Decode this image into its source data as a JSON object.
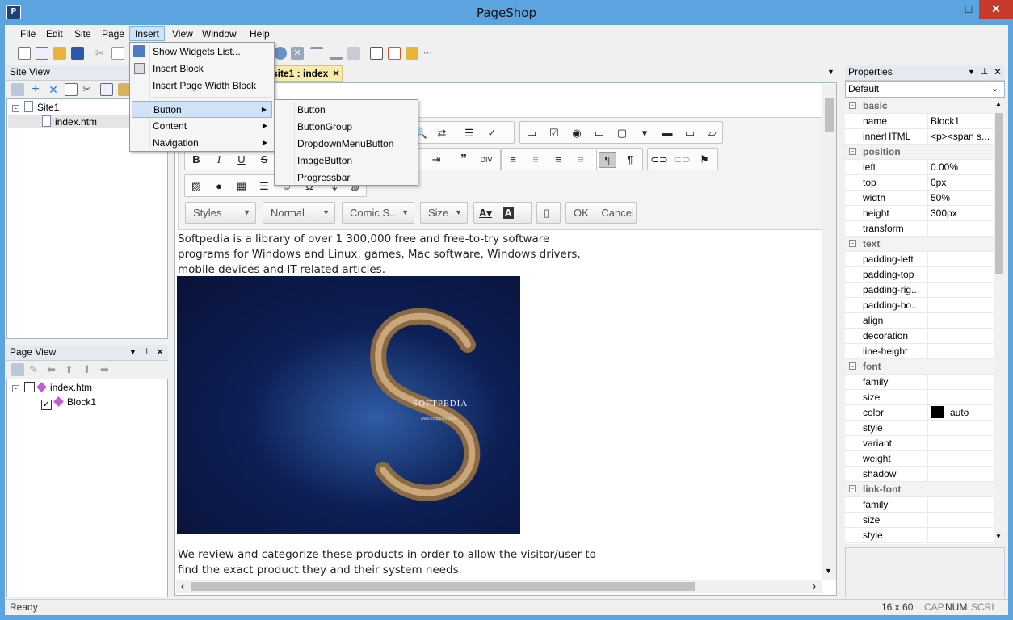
{
  "window": {
    "title": "PageShop",
    "min_label": "_",
    "max_label": "□",
    "close_label": "✕"
  },
  "menubar": [
    "File",
    "Edit",
    "Site",
    "Page",
    "Insert",
    "View",
    "Window",
    "Help"
  ],
  "insert_menu": {
    "items": [
      {
        "label": "Show Widgets List..."
      },
      {
        "label": "Insert Block"
      },
      {
        "label": "Insert Page Width Block"
      },
      {
        "label": "Button"
      },
      {
        "label": "Content"
      },
      {
        "label": "Navigation"
      }
    ]
  },
  "button_submenu": [
    "Button",
    "ButtonGroup",
    "DropdownMenuButton",
    "ImageButton",
    "Progressbar"
  ],
  "site_view": {
    "title": "Site View",
    "site": "Site1",
    "page": "index.htm"
  },
  "page_view": {
    "title": "Page View",
    "page": "index.htm",
    "block": "Block1"
  },
  "editor": {
    "tab_label": "site1 : index",
    "close_glyph": "✕",
    "combos": [
      {
        "label": "Styles"
      },
      {
        "label": "Normal"
      },
      {
        "label": "Comic S..."
      },
      {
        "label": "Size"
      }
    ],
    "ok_label": "OK",
    "cancel_label": "Cancel",
    "text1": "Softpedia is a library of over 1 300,000 free and free-to-try software programs for Windows and Linux, games, Mac software, Windows drivers, mobile devices and IT-related articles.",
    "image_caption": "SOFTPEDIA",
    "image_url_text": "www.softpedia.com",
    "text2": "We review and categorize these products in order to allow the visitor/user to find the exact product they and their system needs."
  },
  "properties": {
    "title": "Properties",
    "preset": "Default",
    "rows": [
      {
        "cat": true,
        "name": "basic"
      },
      {
        "name": "name",
        "value": "Block1"
      },
      {
        "name": "innerHTML",
        "value": "<p><span s..."
      },
      {
        "cat": true,
        "name": "position"
      },
      {
        "name": "left",
        "value": "0.00%"
      },
      {
        "name": "top",
        "value": "0px"
      },
      {
        "name": "width",
        "value": "50%"
      },
      {
        "name": "height",
        "value": "300px"
      },
      {
        "name": "transform",
        "value": ""
      },
      {
        "cat": true,
        "name": "text"
      },
      {
        "name": "padding-left",
        "value": ""
      },
      {
        "name": "padding-top",
        "value": ""
      },
      {
        "name": "padding-rig...",
        "value": ""
      },
      {
        "name": "padding-bo...",
        "value": ""
      },
      {
        "name": "align",
        "value": ""
      },
      {
        "name": "decoration",
        "value": ""
      },
      {
        "name": "line-height",
        "value": ""
      },
      {
        "cat": true,
        "name": "font"
      },
      {
        "name": "family",
        "value": ""
      },
      {
        "name": "size",
        "value": ""
      },
      {
        "name": "color",
        "value": "auto",
        "swatch": "#000000"
      },
      {
        "name": "style",
        "value": ""
      },
      {
        "name": "variant",
        "value": ""
      },
      {
        "name": "weight",
        "value": ""
      },
      {
        "name": "shadow",
        "value": ""
      },
      {
        "cat": true,
        "name": "link-font"
      },
      {
        "name": "family",
        "value": ""
      },
      {
        "name": "size",
        "value": ""
      },
      {
        "name": "style",
        "value": ""
      }
    ]
  },
  "status": {
    "left": "Ready",
    "size": "16 x 60",
    "cap": "CAP",
    "num": "NUM",
    "scrl": "SCRL"
  },
  "colors": {
    "accent": "#5ca4e0",
    "tab_active": "#f9eba9",
    "menu_highlight": "#cfe2f7"
  }
}
